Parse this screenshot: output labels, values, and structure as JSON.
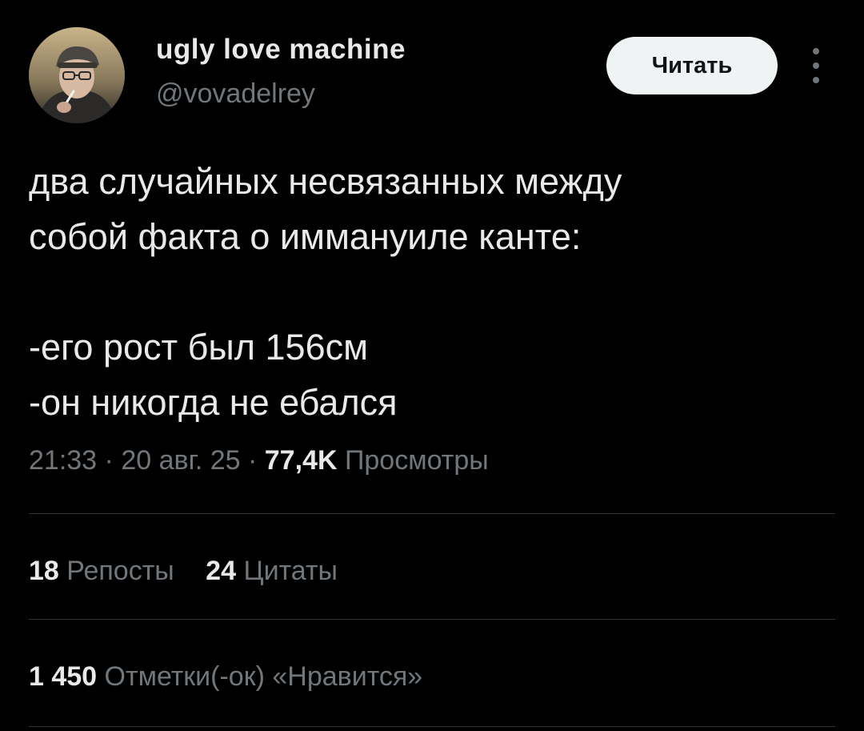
{
  "author": {
    "display_name": "ugly love machine",
    "handle": "@vovadelrey"
  },
  "follow_button": {
    "label": "Читать"
  },
  "more_icon": "more-vertical-icon",
  "tweet": {
    "lines": [
      "два случайных несвязанных между",
      "собой факта о иммануиле канте:",
      "",
      "-его рост был 156см",
      "-он никогда не ебался"
    ]
  },
  "meta": {
    "time": "21:33",
    "separator": "·",
    "date": "20 авг. 25",
    "views_count": "77,4K",
    "views_label": "Просмотры"
  },
  "stats": {
    "reposts": {
      "count": "18",
      "label": "Репосты"
    },
    "quotes": {
      "count": "24",
      "label": "Цитаты"
    },
    "likes": {
      "count": "1 450",
      "label": "Отметки(-ок) «Нравится»"
    }
  },
  "colors": {
    "background": "#000000",
    "primary_text": "#e7e9ea",
    "secondary_text": "#71767b",
    "divider": "#2f3336",
    "button_bg": "#eff3f4"
  }
}
